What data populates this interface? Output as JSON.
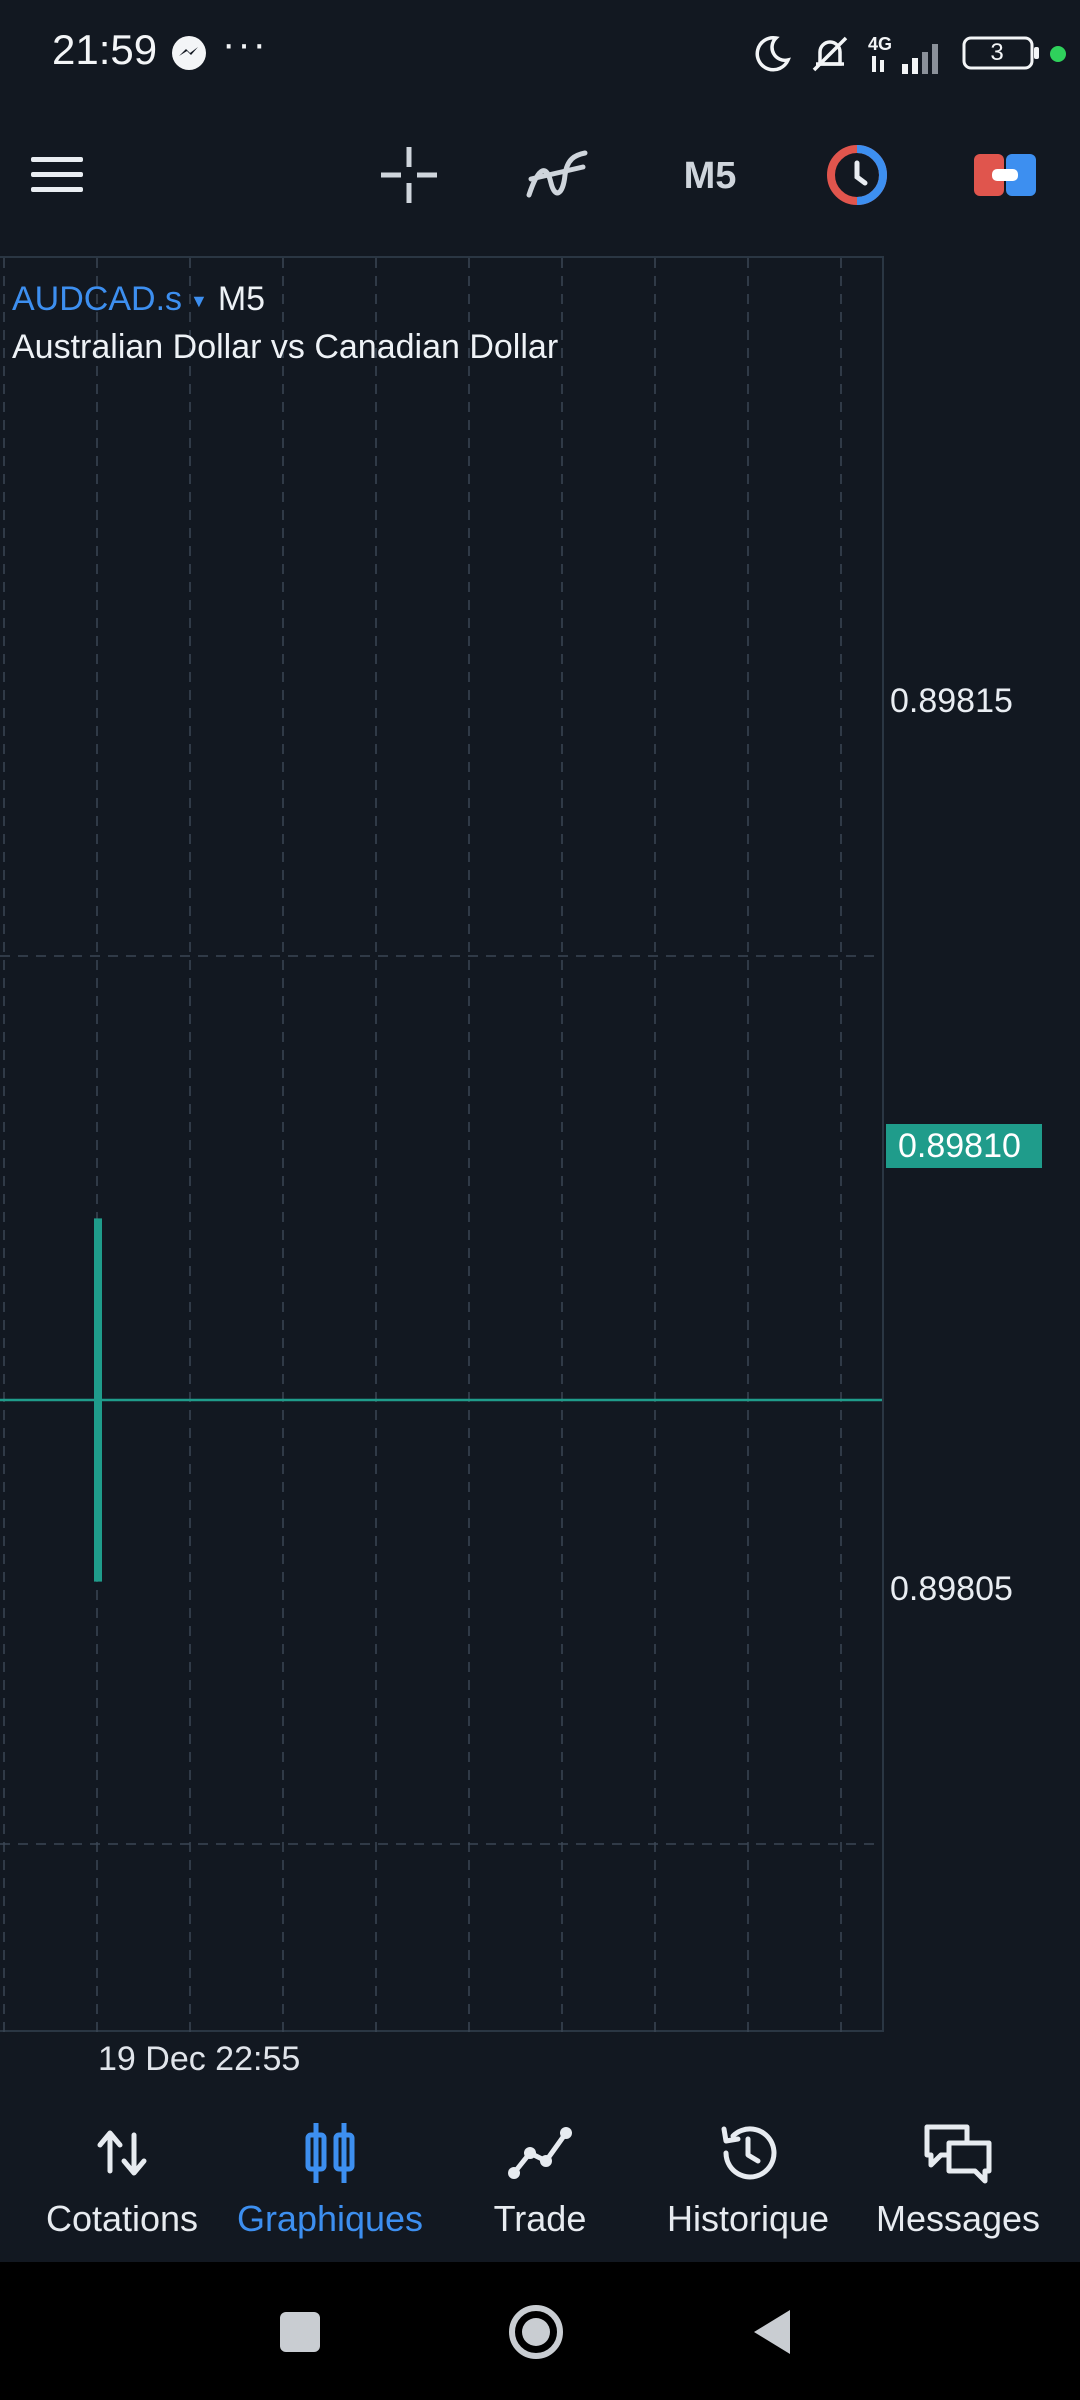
{
  "status_bar": {
    "time": "21:59",
    "network": "4G",
    "battery": "3"
  },
  "toolbar": {
    "timeframe": "M5"
  },
  "chart": {
    "symbol": "AUDCAD.s",
    "timeframe": "M5",
    "description": "Australian Dollar vs Canadian Dollar",
    "price_levels": [
      "0.89815",
      "0.89805"
    ],
    "current_price": "0.89810",
    "time_label": "19 Dec 22:55"
  },
  "chart_data": {
    "type": "candlestick",
    "ylim": [
      0.898,
      0.8982
    ],
    "yticks": [
      "0.89815",
      "0.89805"
    ],
    "xticks": [
      "19 Dec 22:55"
    ],
    "candles": [
      {
        "time": "19 Dec 22:55",
        "open": 0.8981,
        "high": 0.89812,
        "low": 0.89808,
        "close": 0.8981
      }
    ],
    "current_price": 0.8981,
    "colors": {
      "candle": "#1f9c8b",
      "grid": "#3a4654"
    }
  },
  "bottom_nav": {
    "items": [
      {
        "label": "Cotations",
        "icon": "arrows-up-down-icon"
      },
      {
        "label": "Graphiques",
        "icon": "candles-icon"
      },
      {
        "label": "Trade",
        "icon": "trend-line-icon"
      },
      {
        "label": "Historique",
        "icon": "history-icon"
      },
      {
        "label": "Messages",
        "icon": "chat-bubbles-icon"
      }
    ],
    "active_index": 1
  },
  "colors": {
    "background": "#121821",
    "accent": "#3d8ff0",
    "price_tag": "#1f9c8b"
  }
}
